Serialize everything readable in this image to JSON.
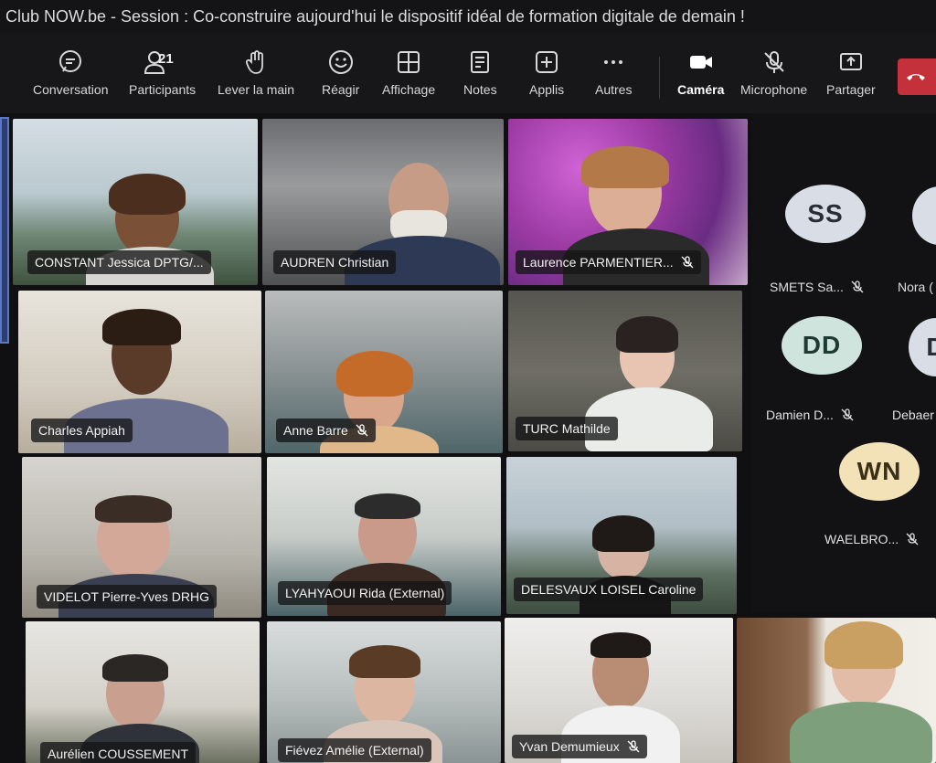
{
  "window": {
    "title": "Club NOW.be - Session : Co-construire aujourd'hui le dispositif idéal de formation digitale de demain !"
  },
  "toolbar": {
    "conversation": "Conversation",
    "participants": "Participants",
    "participants_count": "21",
    "raise_hand": "Lever la main",
    "react": "Réagir",
    "view": "Affichage",
    "notes": "Notes",
    "apps": "Applis",
    "more": "Autres",
    "camera": "Caméra",
    "microphone": "Microphone",
    "share": "Partager"
  },
  "participants": [
    {
      "name": "CONSTANT Jessica DPTG/...",
      "muted": false
    },
    {
      "name": "AUDREN Christian",
      "muted": false
    },
    {
      "name": "Laurence PARMENTIER...",
      "muted": true
    },
    {
      "name": "Charles Appiah",
      "muted": false
    },
    {
      "name": "Anne Barre",
      "muted": true
    },
    {
      "name": "TURC Mathilde",
      "muted": false
    },
    {
      "name": "VIDELOT Pierre-Yves DRHG",
      "muted": false
    },
    {
      "name": "LYAHYAOUI Rida (External)",
      "muted": false
    },
    {
      "name": "DELESVAUX LOISEL Caroline",
      "muted": false
    },
    {
      "name": "Aurélien COUSSEMENT",
      "muted": false
    },
    {
      "name": "Fiévez Amélie (External)",
      "muted": false
    },
    {
      "name": "Yvan Demumieux",
      "muted": true
    }
  ],
  "avatars": [
    {
      "initials": "SS",
      "label": "SMETS Sa...",
      "muted": true,
      "color": "#d9dde6"
    },
    {
      "initials": "",
      "label": "Nora (",
      "muted": false,
      "color": "#d9dde6"
    },
    {
      "initials": "DD",
      "label": "Damien D...",
      "muted": true,
      "color": "#cfe4dc"
    },
    {
      "initials": "D",
      "label": "Debaer",
      "muted": false,
      "color": "#d9dde6"
    },
    {
      "initials": "WN",
      "label": "WAELBRO...",
      "muted": true,
      "color": "#f3e2b8"
    }
  ]
}
